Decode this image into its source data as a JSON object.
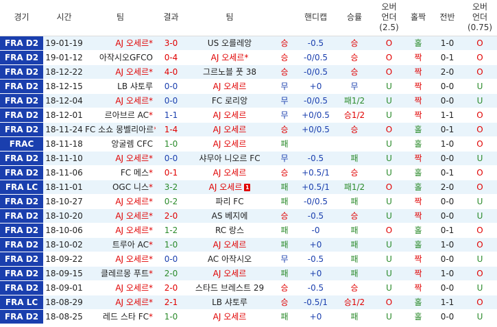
{
  "headers": {
    "league": "경기",
    "date": "시간",
    "home": "팀",
    "score": "결과",
    "away": "팀",
    "result": "",
    "handicap": "핸디캡",
    "hres": "승률",
    "ou25": [
      "오버",
      "언더",
      "(2.5)"
    ],
    "venue": "홀짝",
    "ht": "전반",
    "ou075": [
      "오버",
      "언더",
      "(0.75)"
    ]
  },
  "colors": {
    "league_bg": "#1a3fae",
    "win": "#e00000",
    "draw": "#1a3fae",
    "lose": "#2a8a2a",
    "row_alt": "#e9f4fb"
  },
  "rows": [
    {
      "league": "FRA D2",
      "date": "19-01-19",
      "home": "AJ 오세르",
      "home_star": "*",
      "home_hl": true,
      "score": "3-0",
      "away": "US 오를레앙",
      "away_star": "",
      "away_hl": false,
      "result": "승",
      "hc": "-0.5",
      "hres": "승",
      "ou": "O",
      "oe": "홀",
      "ht": "1-0",
      "ou2": "O"
    },
    {
      "league": "FRA D2",
      "date": "19-01-12",
      "home": "아작시오GFCO",
      "home_star": "",
      "home_hl": false,
      "score": "0-4",
      "away": "AJ 오세르",
      "away_star": "*",
      "away_hl": true,
      "result": "승",
      "hc": "-0/0.5",
      "hres": "승",
      "ou": "O",
      "oe": "짝",
      "ht": "0-1",
      "ou2": "O"
    },
    {
      "league": "FRA D2",
      "date": "18-12-22",
      "home": "AJ 오세르",
      "home_star": "*",
      "home_hl": true,
      "score": "4-0",
      "away": "그르노블 풋 38",
      "away_star": "",
      "away_hl": false,
      "result": "승",
      "hc": "-0/0.5",
      "hres": "승",
      "ou": "O",
      "oe": "짝",
      "ht": "2-0",
      "ou2": "O"
    },
    {
      "league": "FRA D2",
      "date": "18-12-15",
      "home": "LB 샤토루",
      "home_star": "",
      "home_hl": false,
      "score": "0-0",
      "away": "AJ 오세르",
      "away_star": "",
      "away_hl": true,
      "result": "무",
      "hc": "+0",
      "hres": "무",
      "ou": "U",
      "oe": "짝",
      "ht": "0-0",
      "ou2": "U"
    },
    {
      "league": "FRA D2",
      "date": "18-12-04",
      "home": "AJ 오세르",
      "home_star": "*",
      "home_hl": true,
      "score": "0-0",
      "away": "FC 로리앙",
      "away_star": "",
      "away_hl": false,
      "result": "무",
      "hc": "-0/0.5",
      "hres": "패1/2",
      "ou": "U",
      "oe": "짝",
      "ht": "0-0",
      "ou2": "U"
    },
    {
      "league": "FRA D2",
      "date": "18-12-01",
      "home": "르아브르 AC",
      "home_star": "*",
      "home_hl": false,
      "score": "1-1",
      "away": "AJ 오세르",
      "away_star": "",
      "away_hl": true,
      "result": "무",
      "hc": "+0/0.5",
      "hres": "승1/2",
      "ou": "U",
      "oe": "짝",
      "ht": "1-1",
      "ou2": "O"
    },
    {
      "league": "FRA D2",
      "date": "18-11-24",
      "home": "FC 소쇼 몽벨리아르",
      "home_star": "*",
      "home_hl": false,
      "score": "1-4",
      "away": "AJ 오세르",
      "away_star": "",
      "away_hl": true,
      "result": "승",
      "hc": "+0/0.5",
      "hres": "승",
      "ou": "O",
      "oe": "홀",
      "ht": "0-1",
      "ou2": "O"
    },
    {
      "league": "FRAC",
      "date": "18-11-18",
      "home": "앙굴렘 CFC",
      "home_star": "",
      "home_hl": false,
      "score": "1-0",
      "away": "AJ 오세르",
      "away_star": "",
      "away_hl": true,
      "result": "패",
      "hc": "",
      "hres": "",
      "ou": "U",
      "oe": "홀",
      "ht": "1-0",
      "ou2": "O"
    },
    {
      "league": "FRA D2",
      "date": "18-11-10",
      "home": "AJ 오세르",
      "home_star": "*",
      "home_hl": true,
      "score": "0-0",
      "away": "샤무아 니오르 FC",
      "away_star": "",
      "away_hl": false,
      "result": "무",
      "hc": "-0.5",
      "hres": "패",
      "ou": "U",
      "oe": "짝",
      "ht": "0-0",
      "ou2": "U"
    },
    {
      "league": "FRA D2",
      "date": "18-11-06",
      "home": "FC 메스",
      "home_star": "*",
      "home_hl": false,
      "score": "0-1",
      "away": "AJ 오세르",
      "away_star": "",
      "away_hl": true,
      "result": "승",
      "hc": "+0.5/1",
      "hres": "승",
      "ou": "U",
      "oe": "홀",
      "ht": "0-1",
      "ou2": "O"
    },
    {
      "league": "FRA LC",
      "date": "18-11-01",
      "home": "OGC 니스",
      "home_star": "*",
      "home_hl": false,
      "score": "3-2",
      "away": "AJ 오세르",
      "away_star": "",
      "away_hl": true,
      "away_card": "1",
      "result": "패",
      "hc": "+0.5/1",
      "hres": "패1/2",
      "ou": "O",
      "oe": "홀",
      "ht": "2-0",
      "ou2": "O"
    },
    {
      "league": "FRA D2",
      "date": "18-10-27",
      "home": "AJ 오세르",
      "home_star": "*",
      "home_hl": true,
      "score": "0-2",
      "away": "파리 FC",
      "away_star": "",
      "away_hl": false,
      "result": "패",
      "hc": "-0/0.5",
      "hres": "패",
      "ou": "U",
      "oe": "짝",
      "ht": "0-0",
      "ou2": "U"
    },
    {
      "league": "FRA D2",
      "date": "18-10-20",
      "home": "AJ 오세르",
      "home_star": "*",
      "home_hl": true,
      "score": "2-0",
      "away": "AS 베지에",
      "away_star": "",
      "away_hl": false,
      "result": "승",
      "hc": "-0.5",
      "hres": "승",
      "ou": "U",
      "oe": "짝",
      "ht": "0-0",
      "ou2": "U"
    },
    {
      "league": "FRA D2",
      "date": "18-10-06",
      "home": "AJ 오세르",
      "home_star": "*",
      "home_hl": true,
      "score": "1-2",
      "away": "RC 랑스",
      "away_star": "",
      "away_hl": false,
      "result": "패",
      "hc": "-0",
      "hres": "패",
      "ou": "O",
      "oe": "홀",
      "ht": "0-1",
      "ou2": "O"
    },
    {
      "league": "FRA D2",
      "date": "18-10-02",
      "home": "트루아 AC",
      "home_star": "*",
      "home_hl": false,
      "score": "1-0",
      "away": "AJ 오세르",
      "away_star": "",
      "away_hl": true,
      "result": "패",
      "hc": "+0",
      "hres": "패",
      "ou": "U",
      "oe": "홀",
      "ht": "1-0",
      "ou2": "O"
    },
    {
      "league": "FRA D2",
      "date": "18-09-22",
      "home": "AJ 오세르",
      "home_star": "*",
      "home_hl": true,
      "score": "0-0",
      "away": "AC 아작시오",
      "away_star": "",
      "away_hl": false,
      "result": "무",
      "hc": "-0.5",
      "hres": "패",
      "ou": "U",
      "oe": "짝",
      "ht": "0-0",
      "ou2": "U"
    },
    {
      "league": "FRA D2",
      "date": "18-09-15",
      "home": "클레르몽 푸트",
      "home_star": "*",
      "home_hl": false,
      "score": "2-0",
      "away": "AJ 오세르",
      "away_star": "",
      "away_hl": true,
      "result": "패",
      "hc": "+0",
      "hres": "패",
      "ou": "U",
      "oe": "짝",
      "ht": "1-0",
      "ou2": "O"
    },
    {
      "league": "FRA D2",
      "date": "18-09-01",
      "home": "AJ 오세르",
      "home_star": "*",
      "home_hl": true,
      "score": "2-0",
      "away": "스타드 브레스트 29",
      "away_star": "",
      "away_hl": false,
      "result": "승",
      "hc": "-0.5",
      "hres": "승",
      "ou": "U",
      "oe": "짝",
      "ht": "0-0",
      "ou2": "U"
    },
    {
      "league": "FRA LC",
      "date": "18-08-29",
      "home": "AJ 오세르",
      "home_star": "*",
      "home_hl": true,
      "score": "2-1",
      "away": "LB 샤토루",
      "away_star": "",
      "away_hl": false,
      "result": "승",
      "hc": "-0.5/1",
      "hres": "승1/2",
      "ou": "O",
      "oe": "홀",
      "ht": "1-1",
      "ou2": "O"
    },
    {
      "league": "FRA D2",
      "date": "18-08-25",
      "home": "레드 스타 FC",
      "home_star": "*",
      "home_hl": false,
      "score": "1-0",
      "away": "AJ 오세르",
      "away_star": "",
      "away_hl": true,
      "result": "패",
      "hc": "+0",
      "hres": "패",
      "ou": "U",
      "oe": "홀",
      "ht": "0-0",
      "ou2": "U"
    }
  ]
}
